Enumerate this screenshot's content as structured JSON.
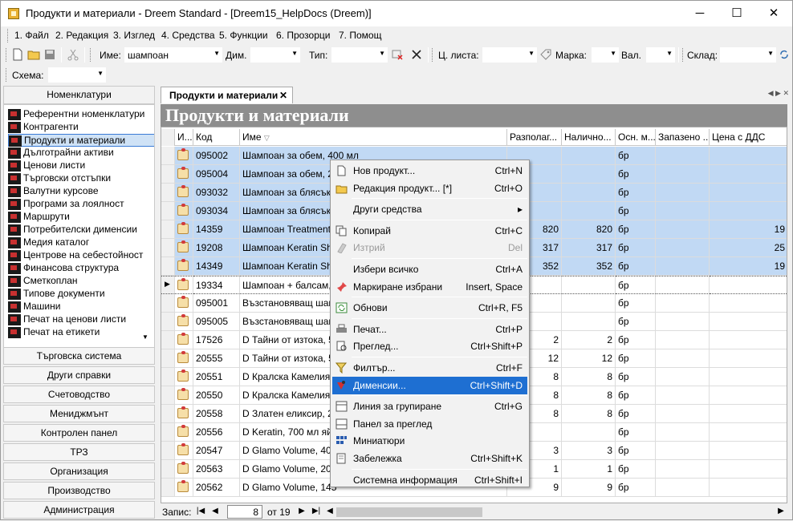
{
  "window": {
    "title": "Продукти и материали - Dreem Standard - [Dreem15_HelpDocs (Dreem)]",
    "minimize": "─",
    "maximize": "☐",
    "close": "✕"
  },
  "menu": [
    {
      "label": "1. Файл"
    },
    {
      "label": "2. Редакция"
    },
    {
      "label": "3. Изглед"
    },
    {
      "label": "4. Средства"
    },
    {
      "label": "5. Функции"
    },
    {
      "label": "6. Прозорци"
    },
    {
      "label": "7. Помощ"
    }
  ],
  "toolbar": {
    "name_label": "Име:",
    "name_value": "шампоан",
    "dim_label": "Дим.",
    "type_label": "Тип:",
    "price_list_label": "Ц. листа:",
    "brand_label": "Марка:",
    "currency_label": "Вал.",
    "warehouse_label": "Склад:",
    "scheme_label": "Схема:"
  },
  "leftnav": {
    "header": "Номенклатури",
    "items": [
      "Референтни номенклатури",
      "Контрагенти",
      "Продукти и материали",
      "Дълготрайни активи",
      "Ценови листи",
      "Търговски отстъпки",
      "Валутни курсове",
      "Програми за лоялност",
      "Маршрути",
      "Потребителски дименсии",
      "Медия каталог",
      "Центрове на себестойност",
      "Финансова структура",
      "Сметкоплан",
      "Типове документи",
      "Машини",
      "Печат на ценови листи",
      "Печат на етикети"
    ],
    "sections": [
      "Търговска система",
      "Други справки",
      "Счетоводство",
      "Мениджмънт",
      "Контролен панел",
      "ТРЗ",
      "Организация",
      "Производство",
      "Администрация"
    ]
  },
  "document": {
    "tab_label": "Продукти и материали",
    "tab_close": "✕",
    "header": "Продукти и материали"
  },
  "grid": {
    "columns": [
      "И...",
      "Код",
      "Име",
      "Разполаг...",
      "Налично...",
      "Осн. м...",
      "Запазено ...",
      "Цена с ДДС"
    ],
    "rows": [
      {
        "code": "095002",
        "name": "Шампоан за обем, 400 мл",
        "avail": "",
        "onhand": "",
        "unit": "бр",
        "reserved": "",
        "price": "",
        "selected": true
      },
      {
        "code": "095004",
        "name": "Шампоан за обем, 20",
        "avail": "",
        "onhand": "",
        "unit": "бр",
        "reserved": "",
        "price": "",
        "selected": true
      },
      {
        "code": "093032",
        "name": "Шампоан за блясък,",
        "avail": "",
        "onhand": "",
        "unit": "бр",
        "reserved": "",
        "price": "",
        "selected": true
      },
      {
        "code": "093034",
        "name": "Шампоан за блясък,",
        "avail": "",
        "onhand": "",
        "unit": "бр",
        "reserved": "",
        "price": "",
        "selected": true
      },
      {
        "code": "14359",
        "name": "Шампоан Treatment",
        "avail": "820",
        "onhand": "820",
        "unit": "бр",
        "reserved": "",
        "price": "19",
        "selected": true
      },
      {
        "code": "19208",
        "name": "Шампоан Keratin Sha",
        "avail": "317",
        "onhand": "317",
        "unit": "бр",
        "reserved": "",
        "price": "25",
        "selected": true
      },
      {
        "code": "14349",
        "name": "Шампоан Keratin Sha",
        "avail": "352",
        "onhand": "352",
        "unit": "бр",
        "reserved": "",
        "price": "19",
        "selected": true
      },
      {
        "code": "19334",
        "name": "Шампоан + балсам,",
        "avail": "",
        "onhand": "",
        "unit": "бр",
        "reserved": "",
        "price": "",
        "selected": false,
        "current": true
      },
      {
        "code": "095001",
        "name": "Възстановяващ шам",
        "avail": "",
        "onhand": "",
        "unit": "бр",
        "reserved": "",
        "price": "",
        "selected": false
      },
      {
        "code": "095005",
        "name": "Възстановяващ шам",
        "avail": "",
        "onhand": "",
        "unit": "бр",
        "reserved": "",
        "price": "",
        "selected": false
      },
      {
        "code": "17526",
        "name": "D Тайни от изтока, 5",
        "avail": "2",
        "onhand": "2",
        "unit": "бр",
        "reserved": "",
        "price": "",
        "selected": false
      },
      {
        "code": "20555",
        "name": "D Тайни от изтока, 50",
        "avail": "12",
        "onhand": "12",
        "unit": "бр",
        "reserved": "",
        "price": "",
        "selected": false
      },
      {
        "code": "20551",
        "name": "D Кралска Камелия,",
        "avail": "8",
        "onhand": "8",
        "unit": "бр",
        "reserved": "",
        "price": "",
        "selected": false
      },
      {
        "code": "20550",
        "name": "D Кралска Камелия,",
        "avail": "8",
        "onhand": "8",
        "unit": "бр",
        "reserved": "",
        "price": "",
        "selected": false
      },
      {
        "code": "20558",
        "name": "D Златен еликсир, 20",
        "avail": "8",
        "onhand": "8",
        "unit": "бр",
        "reserved": "",
        "price": "",
        "selected": false
      },
      {
        "code": "20556",
        "name": "D Keratin, 700 мл яйч",
        "avail": "",
        "onhand": "",
        "unit": "бр",
        "reserved": "",
        "price": "",
        "selected": false
      },
      {
        "code": "20547",
        "name": "D Glamo Volume, 400",
        "avail": "3",
        "onhand": "3",
        "unit": "бр",
        "reserved": "",
        "price": "",
        "selected": false
      },
      {
        "code": "20563",
        "name": "D Glamo Volume, 200",
        "avail": "1",
        "onhand": "1",
        "unit": "бр",
        "reserved": "",
        "price": "",
        "selected": false
      },
      {
        "code": "20562",
        "name": "D Glamo Volume, 145",
        "avail": "9",
        "onhand": "9",
        "unit": "бр",
        "reserved": "",
        "price": "",
        "selected": false
      }
    ]
  },
  "status": {
    "records_label": "Запис:",
    "current": "8",
    "of_label": "от 19"
  },
  "context_menu": {
    "items": [
      {
        "label": "Нов продукт...",
        "shortcut": "Ctrl+N",
        "icon": "new-doc-icon"
      },
      {
        "label": "Редакция продукт... [*]",
        "shortcut": "Ctrl+O",
        "icon": "edit-folder-icon"
      },
      {
        "sep": true
      },
      {
        "label": "Други средства",
        "shortcut": "▸",
        "icon": ""
      },
      {
        "sep": true
      },
      {
        "label": "Копирай",
        "shortcut": "Ctrl+C",
        "icon": "copy-icon"
      },
      {
        "label": "Изтрий",
        "shortcut": "Del",
        "icon": "delete-icon",
        "disabled": true
      },
      {
        "sep": true
      },
      {
        "label": "Избери всичко",
        "shortcut": "Ctrl+A",
        "icon": ""
      },
      {
        "label": "Маркиране избрани",
        "shortcut": "Insert, Space",
        "icon": "pin-icon"
      },
      {
        "sep": true
      },
      {
        "label": "Обнови",
        "shortcut": "Ctrl+R, F5",
        "icon": "refresh-icon"
      },
      {
        "sep": true
      },
      {
        "label": "Печат...",
        "shortcut": "Ctrl+P",
        "icon": "print-icon"
      },
      {
        "label": "Преглед...",
        "shortcut": "Ctrl+Shift+P",
        "icon": "preview-icon"
      },
      {
        "sep": true
      },
      {
        "label": "Филтър...",
        "shortcut": "Ctrl+F",
        "icon": "filter-icon"
      },
      {
        "label": "Дименсии...",
        "shortcut": "Ctrl+Shift+D",
        "icon": "dimensions-icon",
        "highlighted": true
      },
      {
        "sep": true
      },
      {
        "label": "Линия за групиране",
        "shortcut": "Ctrl+G",
        "icon": "grouping-icon"
      },
      {
        "label": "Панел за преглед",
        "shortcut": "",
        "icon": "preview-panel-icon"
      },
      {
        "label": "Миниатюри",
        "shortcut": "",
        "icon": "thumbnails-icon"
      },
      {
        "label": "Забележка",
        "shortcut": "Ctrl+Shift+K",
        "icon": "note-icon"
      },
      {
        "sep": true
      },
      {
        "label": "Системна информация",
        "shortcut": "Ctrl+Shift+I",
        "icon": ""
      }
    ]
  },
  "colors": {
    "selection": "#c1d9f4",
    "highlight": "#1e6fd2",
    "header_band": "#8e8e8e"
  }
}
